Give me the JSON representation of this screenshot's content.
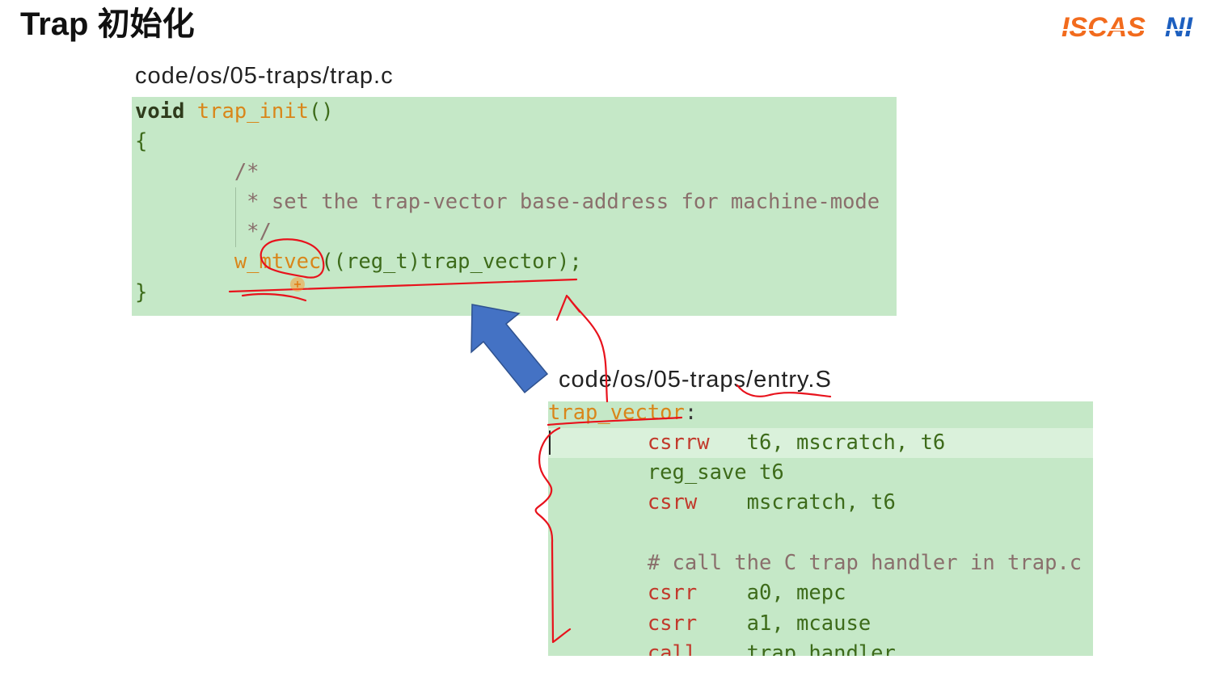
{
  "slide": {
    "title": "Trap 初始化",
    "logo": {
      "primary": "ISCAS",
      "secondary": "NI",
      "primary_color": "#f26b1d",
      "secondary_color": "#1d5fbf"
    }
  },
  "style": {
    "code_background": "#c5e8c7",
    "current_line_background": "#daf1db",
    "annotation_color": "#e8121c",
    "arrow_color": "#4472c4"
  },
  "trap_c": {
    "path": "code/os/05-traps/trap.c",
    "lines": [
      [
        {
          "text": "void ",
          "color": "#2f3b1c",
          "bold": true
        },
        {
          "text": "trap_init",
          "color": "#d9861a"
        },
        {
          "text": "()",
          "color": "#3d6b1a"
        }
      ],
      [
        {
          "text": "{",
          "color": "#3d6b1a"
        }
      ],
      [
        {
          "text": "        /*",
          "color": "#8a6f6c"
        }
      ],
      [
        {
          "text": "         * set the trap-vector base-address for machine-mode",
          "color": "#8a6f6c"
        }
      ],
      [
        {
          "text": "         */",
          "color": "#8a6f6c"
        }
      ],
      [
        {
          "text": "        w_mtvec",
          "color": "#d9861a"
        },
        {
          "text": "((reg_t)trap_vector);",
          "color": "#3d6b1a"
        }
      ],
      [
        {
          "text": "}",
          "color": "#3d6b1a"
        }
      ]
    ]
  },
  "entry_s": {
    "path": "code/os/05-traps/entry.S",
    "current_line": 1,
    "lines": [
      [
        {
          "text": "trap_vector",
          "color": "#d9861a"
        },
        {
          "text": ":",
          "color": "#3a3a3a"
        }
      ],
      [
        {
          "text": "        csrrw",
          "color": "#c23a2c"
        },
        {
          "text": "   t6, mscratch, t6",
          "color": "#3d6b1a"
        }
      ],
      [
        {
          "text": "        reg_save t6",
          "color": "#3d6b1a"
        }
      ],
      [
        {
          "text": "        csrw",
          "color": "#c23a2c"
        },
        {
          "text": "    mscratch, t6",
          "color": "#3d6b1a"
        }
      ],
      [],
      [
        {
          "text": "        # call the C trap handler in trap.c",
          "color": "#8a6f6c"
        }
      ],
      [
        {
          "text": "        csrr",
          "color": "#c23a2c"
        },
        {
          "text": "    a0, mepc",
          "color": "#3d6b1a"
        }
      ],
      [
        {
          "text": "        csrr",
          "color": "#c23a2c"
        },
        {
          "text": "    a1, mcause",
          "color": "#3d6b1a"
        }
      ],
      [
        {
          "text": "        call",
          "color": "#c23a2c"
        },
        {
          "text": "    trap_handler",
          "color": "#3d6b1a"
        }
      ]
    ]
  }
}
